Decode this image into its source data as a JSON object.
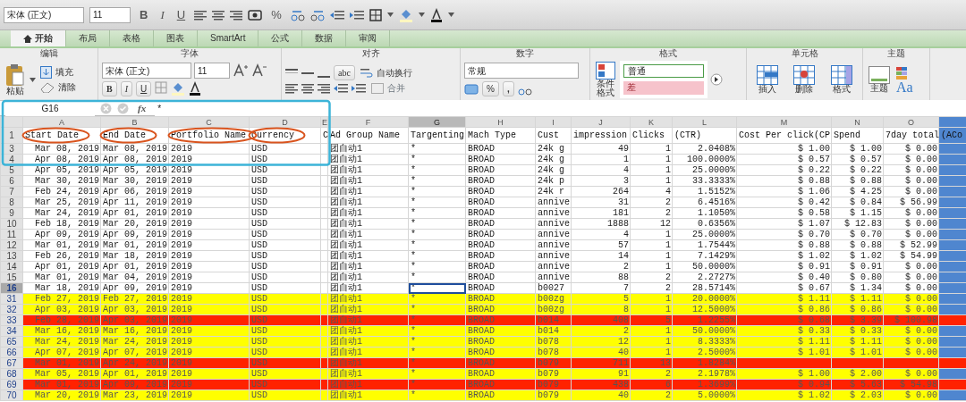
{
  "toolbar": {
    "font": "宋体 (正文)",
    "size": "11",
    "bold": "B",
    "italic": "I",
    "underline": "U",
    "percent": "%"
  },
  "tabs": [
    {
      "label": "开始",
      "selected": true
    },
    {
      "label": "布局",
      "selected": false
    },
    {
      "label": "表格",
      "selected": false
    },
    {
      "label": "图表",
      "selected": false
    },
    {
      "label": "SmartArt",
      "selected": false
    },
    {
      "label": "公式",
      "selected": false
    },
    {
      "label": "数据",
      "selected": false
    },
    {
      "label": "审阅",
      "selected": false
    }
  ],
  "ribbon": {
    "edit": {
      "title": "编辑",
      "paste": "粘贴",
      "fill": "填充",
      "clear": "清除"
    },
    "font": {
      "title": "字体",
      "font": "宋体 (正文)",
      "size": "11",
      "bold": "B",
      "italic": "I",
      "underline": "U"
    },
    "align": {
      "title": "对齐",
      "abc": "abc",
      "wrap": "自动换行",
      "merge": "合并"
    },
    "number": {
      "title": "数字",
      "format": "常规",
      "percent": "%",
      "comma": ","
    },
    "format": {
      "title": "格式",
      "conditional": "条件格式",
      "styles": [
        {
          "label": "普通",
          "kind": "normal"
        },
        {
          "label": "差",
          "kind": "bad"
        }
      ]
    },
    "cells": {
      "title": "单元格",
      "buttons": [
        "插入",
        "删除",
        "格式"
      ]
    },
    "theme": {
      "title": "主题",
      "themes": "主题",
      "fonts": "Aa"
    }
  },
  "formula_bar": {
    "cell": "G16",
    "fx": "fx",
    "value": "*"
  },
  "sheet": {
    "columns": [
      {
        "letter": "A",
        "selected": false,
        "circled": true
      },
      {
        "letter": "B",
        "selected": false,
        "circled": true
      },
      {
        "letter": "C",
        "selected": false,
        "circled": true
      },
      {
        "letter": "D",
        "selected": false,
        "circled": true
      },
      {
        "letter": "E",
        "selected": false
      },
      {
        "letter": "F",
        "selected": false
      },
      {
        "letter": "G",
        "selected": true
      },
      {
        "letter": "H",
        "selected": false
      },
      {
        "letter": "I",
        "selected": false
      },
      {
        "letter": "J",
        "selected": false
      },
      {
        "letter": "K",
        "selected": false
      },
      {
        "letter": "L",
        "selected": false
      },
      {
        "letter": "M",
        "selected": false
      },
      {
        "letter": "N",
        "selected": false
      },
      {
        "letter": "O",
        "selected": false
      },
      {
        "color": "#4f86cf"
      }
    ],
    "header_row": {
      "number": "1",
      "cells": {
        "A": "Start Date",
        "B": "End Date",
        "C": "Portfolio Name",
        "D": "Currency",
        "E": "C",
        "F": "Ad Group Name",
        "G": "Targenting",
        "H": "Mach Type",
        "I": "Cust",
        "J": "impression",
        "K": "Clicks",
        "L": "(CTR)",
        "M": "Cost Per click(CP",
        "N": "Spend",
        "O": "7day total",
        "P": "(ACo"
      }
    },
    "rows": [
      {
        "number": "3",
        "selected": false,
        "cells": {
          "A": "Mar 08, 2019",
          "B": "Mar 08, 2019",
          "C": "2019",
          "D": "USD",
          "F": "团自动1",
          "G": "*",
          "H": "BROAD",
          "I": "24k g",
          "J": "49",
          "K": "1",
          "L": "2.0408%",
          "M": "$ 1.00",
          "N": "$ 1.00",
          "O": "$ 0.00"
        }
      },
      {
        "number": "4",
        "selected": false,
        "cells": {
          "A": "Apr 08, 2019",
          "B": "Apr 08, 2019",
          "C": "2019",
          "D": "USD",
          "F": "团自动1",
          "G": "*",
          "H": "BROAD",
          "I": "24k g",
          "J": "1",
          "K": "1",
          "L": "100.0000%",
          "M": "$ 0.57",
          "N": "$ 0.57",
          "O": "$ 0.00"
        }
      },
      {
        "number": "5",
        "selected": false,
        "cells": {
          "A": "Apr 05, 2019",
          "B": "Apr 05, 2019",
          "C": "2019",
          "D": "USD",
          "F": "团自动1",
          "G": "*",
          "H": "BROAD",
          "I": "24k g",
          "J": "4",
          "K": "1",
          "L": "25.0000%",
          "M": "$ 0.22",
          "N": "$ 0.22",
          "O": "$ 0.00"
        }
      },
      {
        "number": "6",
        "selected": false,
        "cells": {
          "A": "Mar 30, 2019",
          "B": "Mar 30, 2019",
          "C": "2019",
          "D": "USD",
          "F": "团自动1",
          "G": "*",
          "H": "BROAD",
          "I": "24k p",
          "J": "3",
          "K": "1",
          "L": "33.3333%",
          "M": "$ 0.88",
          "N": "$ 0.88",
          "O": "$ 0.00"
        }
      },
      {
        "number": "7",
        "selected": false,
        "cells": {
          "A": "Feb 24, 2019",
          "B": "Apr 06, 2019",
          "C": "2019",
          "D": "USD",
          "F": "团自动1",
          "G": "*",
          "H": "BROAD",
          "I": "24k r",
          "J": "264",
          "K": "4",
          "L": "1.5152%",
          "M": "$ 1.06",
          "N": "$ 4.25",
          "O": "$ 0.00"
        }
      },
      {
        "number": "8",
        "selected": false,
        "cells": {
          "A": "Mar 25, 2019",
          "B": "Apr 11, 2019",
          "C": "2019",
          "D": "USD",
          "F": "团自动1",
          "G": "*",
          "H": "BROAD",
          "I": "annive",
          "J": "31",
          "K": "2",
          "L": "6.4516%",
          "M": "$ 0.42",
          "N": "$ 0.84",
          "O": "$ 56.99"
        }
      },
      {
        "number": "9",
        "selected": false,
        "cells": {
          "A": "Mar 24, 2019",
          "B": "Apr 01, 2019",
          "C": "2019",
          "D": "USD",
          "F": "团自动1",
          "G": "*",
          "H": "BROAD",
          "I": "annive",
          "J": "181",
          "K": "2",
          "L": "1.1050%",
          "M": "$ 0.58",
          "N": "$ 1.15",
          "O": "$ 0.00"
        }
      },
      {
        "number": "10",
        "selected": false,
        "cells": {
          "A": "Feb 18, 2019",
          "B": "Mar 20, 2019",
          "C": "2019",
          "D": "USD",
          "F": "团自动1",
          "G": "*",
          "H": "BROAD",
          "I": "annive",
          "J": "1888",
          "K": "12",
          "L": "0.6356%",
          "M": "$ 1.07",
          "N": "$ 12.83",
          "O": "$ 0.00"
        }
      },
      {
        "number": "11",
        "selected": false,
        "cells": {
          "A": "Apr 09, 2019",
          "B": "Apr 09, 2019",
          "C": "2019",
          "D": "USD",
          "F": "团自动1",
          "G": "*",
          "H": "BROAD",
          "I": "annive",
          "J": "4",
          "K": "1",
          "L": "25.0000%",
          "M": "$ 0.70",
          "N": "$ 0.70",
          "O": "$ 0.00"
        }
      },
      {
        "number": "12",
        "selected": false,
        "cells": {
          "A": "Mar 01, 2019",
          "B": "Mar 01, 2019",
          "C": "2019",
          "D": "USD",
          "F": "团自动1",
          "G": "*",
          "H": "BROAD",
          "I": "annive",
          "J": "57",
          "K": "1",
          "L": "1.7544%",
          "M": "$ 0.88",
          "N": "$ 0.88",
          "O": "$ 52.99"
        }
      },
      {
        "number": "13",
        "selected": false,
        "cells": {
          "A": "Feb 26, 2019",
          "B": "Mar 18, 2019",
          "C": "2019",
          "D": "USD",
          "F": "团自动1",
          "G": "*",
          "H": "BROAD",
          "I": "annive",
          "J": "14",
          "K": "1",
          "L": "7.1429%",
          "M": "$ 1.02",
          "N": "$ 1.02",
          "O": "$ 54.99"
        }
      },
      {
        "number": "14",
        "selected": false,
        "cells": {
          "A": "Apr 01, 2019",
          "B": "Apr 01, 2019",
          "C": "2019",
          "D": "USD",
          "F": "团自动1",
          "G": "*",
          "H": "BROAD",
          "I": "annive",
          "J": "2",
          "K": "1",
          "L": "50.0000%",
          "M": "$ 0.91",
          "N": "$ 0.91",
          "O": "$ 0.00"
        }
      },
      {
        "number": "15",
        "selected": false,
        "cells": {
          "A": "Mar 01, 2019",
          "B": "Mar 04, 2019",
          "C": "2019",
          "D": "USD",
          "F": "团自动1",
          "G": "*",
          "H": "BROAD",
          "I": "annive",
          "J": "88",
          "K": "2",
          "L": "2.2727%",
          "M": "$ 0.40",
          "N": "$ 0.80",
          "O": "$ 0.00"
        }
      },
      {
        "number": "16",
        "selected": true,
        "cells": {
          "A": "Mar 18, 2019",
          "B": "Apr 09, 2019",
          "C": "2019",
          "D": "USD",
          "F": "团自动1",
          "G": "*",
          "H": "BROAD",
          "I": "b0027",
          "J": "7",
          "K": "2",
          "L": "28.5714%",
          "M": "$ 0.67",
          "N": "$ 1.34",
          "O": "$ 0.00"
        }
      },
      {
        "number": "31",
        "selected": false,
        "color": "#ffff00",
        "cells": {
          "A": "Feb 27, 2019",
          "B": "Feb 27, 2019",
          "C": "2019",
          "D": "USD",
          "F": "团自动1",
          "G": "*",
          "H": "BROAD",
          "I": "b00zg",
          "J": "5",
          "K": "1",
          "L": "20.0000%",
          "M": "$ 1.11",
          "N": "$ 1.11",
          "O": "$ 0.00"
        }
      },
      {
        "number": "32",
        "selected": false,
        "color": "#ffff00",
        "cells": {
          "A": "Apr 03, 2019",
          "B": "Apr 03, 2019",
          "C": "2019",
          "D": "USD",
          "F": "团自动1",
          "G": "*",
          "H": "BROAD",
          "I": "b00zg",
          "J": "8",
          "K": "1",
          "L": "12.5000%",
          "M": "$ 0.86",
          "N": "$ 0.86",
          "O": "$ 0.00"
        }
      },
      {
        "number": "33",
        "selected": false,
        "color": "#ff2200",
        "full": true,
        "cells": {
          "A": "Feb 28, 2019",
          "B": "Apr 03, 2019",
          "C": "2019",
          "D": "USD",
          "F": "团自动1",
          "G": "*",
          "H": "BROAD",
          "I": "b014",
          "J": "408",
          "K": "5",
          "L": "1.2255%",
          "M": "$ 0.68",
          "N": "$ 3.39",
          "O": "$ 100.98"
        }
      },
      {
        "number": "34",
        "selected": false,
        "color": "#ffff00",
        "cells": {
          "A": "Mar 16, 2019",
          "B": "Mar 16, 2019",
          "C": "2019",
          "D": "USD",
          "F": "团自动1",
          "G": "*",
          "H": "BROAD",
          "I": "b014",
          "J": "2",
          "K": "1",
          "L": "50.0000%",
          "M": "$ 0.33",
          "N": "$ 0.33",
          "O": "$ 0.00"
        }
      },
      {
        "number": "65",
        "selected": false,
        "color": "#ffff00",
        "cells": {
          "A": "Mar 24, 2019",
          "B": "Mar 24, 2019",
          "C": "2019",
          "D": "USD",
          "F": "团自动1",
          "G": "*",
          "H": "BROAD",
          "I": "b078",
          "J": "12",
          "K": "1",
          "L": "8.3333%",
          "M": "$ 1.11",
          "N": "$ 1.11",
          "O": "$ 0.00"
        }
      },
      {
        "number": "66",
        "selected": false,
        "color": "#ffff00",
        "cells": {
          "A": "Apr 07, 2019",
          "B": "Apr 07, 2019",
          "C": "2019",
          "D": "USD",
          "F": "团自动1",
          "G": "*",
          "H": "BROAD",
          "I": "b078",
          "J": "40",
          "K": "1",
          "L": "2.5000%",
          "M": "$ 1.01",
          "N": "$ 1.01",
          "O": "$ 0.00"
        }
      },
      {
        "number": "67",
        "selected": false,
        "color": "#ff2200",
        "full": true,
        "cells": {
          "A": "Mar 01, 2019",
          "B": "Apr 24, 2019",
          "C": "2019",
          "D": "USD",
          "F": "团自动1",
          "G": "*",
          "H": "BROAD",
          "I": "b079",
          "J": "711",
          "K": "13",
          "L": "1.8284%"
        }
      },
      {
        "number": "68",
        "selected": false,
        "color": "#ffff00",
        "cells": {
          "A": "Mar 05, 2019",
          "B": "Apr 01, 2019",
          "C": "2019",
          "D": "USD",
          "F": "团自动1",
          "G": "*",
          "H": "BROAD",
          "I": "b079",
          "J": "91",
          "K": "2",
          "L": "2.1978%",
          "M": "$ 1.00",
          "N": "$ 2.00",
          "O": "$ 0.00"
        }
      },
      {
        "number": "69",
        "selected": false,
        "color": "#ff2200",
        "full": true,
        "cells": {
          "A": "Mar 01, 2019",
          "B": "Apr 09, 2019",
          "C": "2019",
          "D": "USD",
          "F": "团自动1",
          "G": "*",
          "H": "BROAD",
          "I": "b079",
          "J": "438",
          "K": "6",
          "L": "1.3699%",
          "M": "$ 0.94",
          "N": "$ 5.63",
          "O": "$ 54.98"
        }
      },
      {
        "number": "70",
        "selected": false,
        "color": "#ffff00",
        "cells": {
          "A": "Mar 20, 2019",
          "B": "Mar 23, 2019",
          "C": "2019",
          "D": "USD",
          "F": "团自动1",
          "G": "*",
          "H": "BROAD",
          "I": "b079",
          "J": "40",
          "K": "2",
          "L": "5.0000%",
          "M": "$ 1.02",
          "N": "$ 2.03",
          "O": "$ 0.00"
        }
      }
    ]
  },
  "annotations": {
    "framed": true
  }
}
